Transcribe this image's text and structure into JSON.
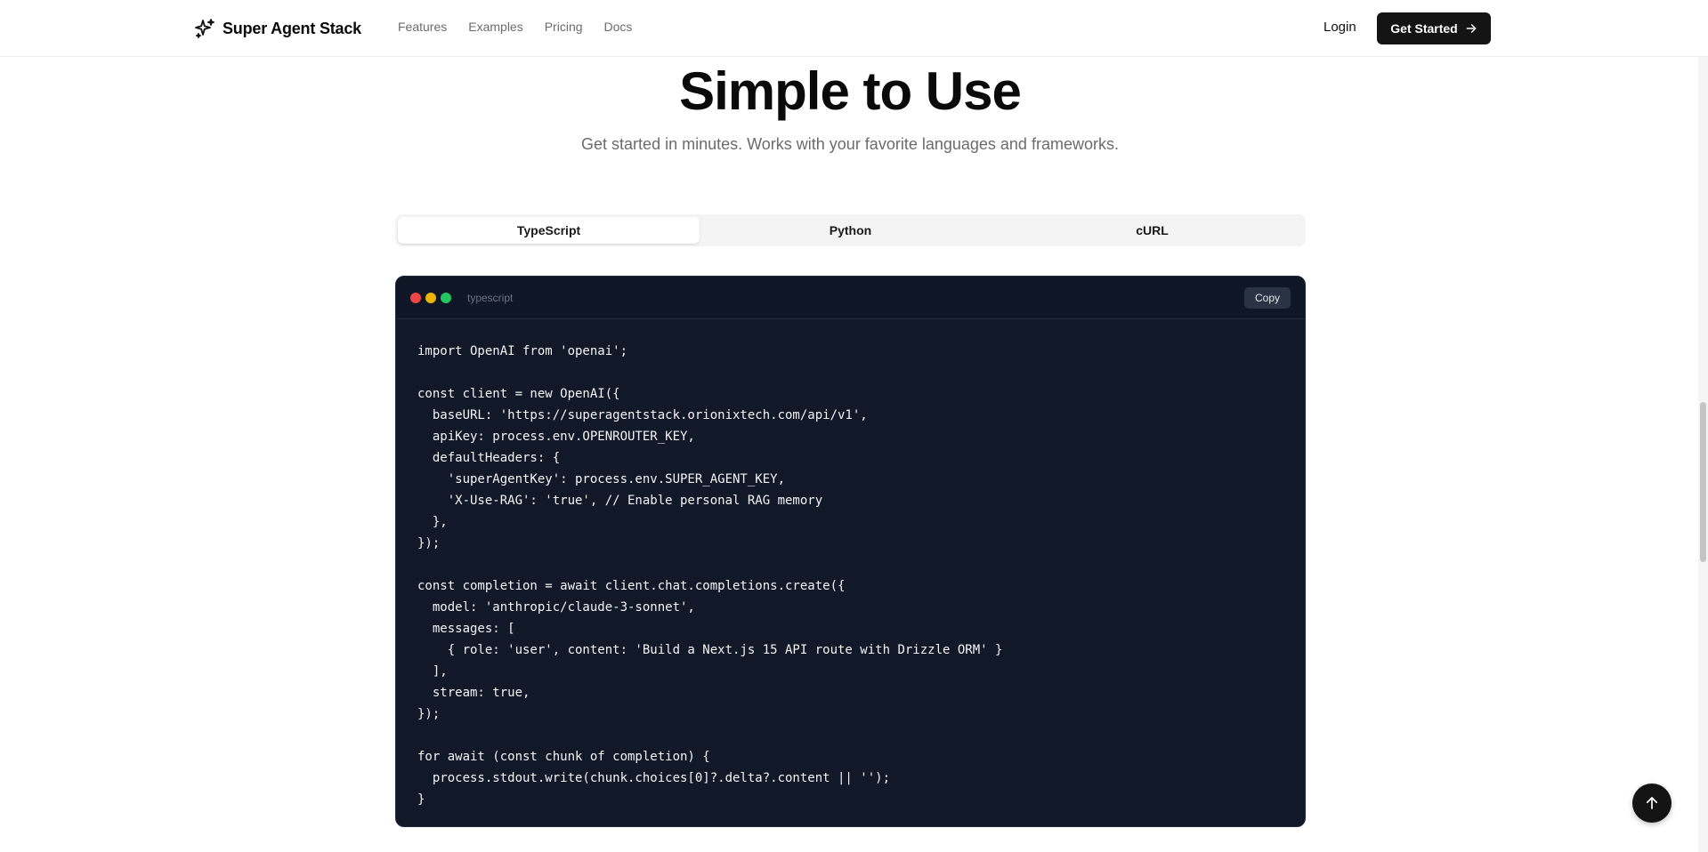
{
  "nav": {
    "brand": "Super Agent Stack",
    "brand_icon": "sparkles-icon",
    "links": [
      "Features",
      "Examples",
      "Pricing",
      "Docs"
    ],
    "login": "Login",
    "cta": "Get Started",
    "cta_icon": "arrow-right-icon"
  },
  "hero": {
    "title": "Simple to Use",
    "subtitle": "Get started in minutes. Works with your favorite languages and frameworks."
  },
  "tabs": {
    "items": [
      "TypeScript",
      "Python",
      "cURL"
    ],
    "active": "TypeScript"
  },
  "code": {
    "language": "typescript",
    "copy_label": "Copy",
    "window_dot_colors": [
      "#ef4444",
      "#eab308",
      "#22c55e"
    ],
    "lines": [
      "import OpenAI from 'openai';",
      "",
      "const client = new OpenAI({",
      "  baseURL: 'https://superagentstack.orionixtech.com/api/v1',",
      "  apiKey: process.env.OPENROUTER_KEY,",
      "  defaultHeaders: {",
      "    'superAgentKey': process.env.SUPER_AGENT_KEY,",
      "    'X-Use-RAG': 'true', // Enable personal RAG memory",
      "  },",
      "});",
      "",
      "const completion = await client.chat.completions.create({",
      "  model: 'anthropic/claude-3-sonnet',",
      "  messages: [",
      "    { role: 'user', content: 'Build a Next.js 15 API route with Drizzle ORM' }",
      "  ],",
      "  stream: true,",
      "});",
      "",
      "for await (const chunk of completion) {",
      "  process.stdout.write(chunk.choices[0]?.delta?.content || '');",
      "}"
    ]
  },
  "scroll_to_top_icon": "arrow-up-icon",
  "colors": {
    "code_bg": "#111827",
    "cta_bg": "#141414"
  }
}
